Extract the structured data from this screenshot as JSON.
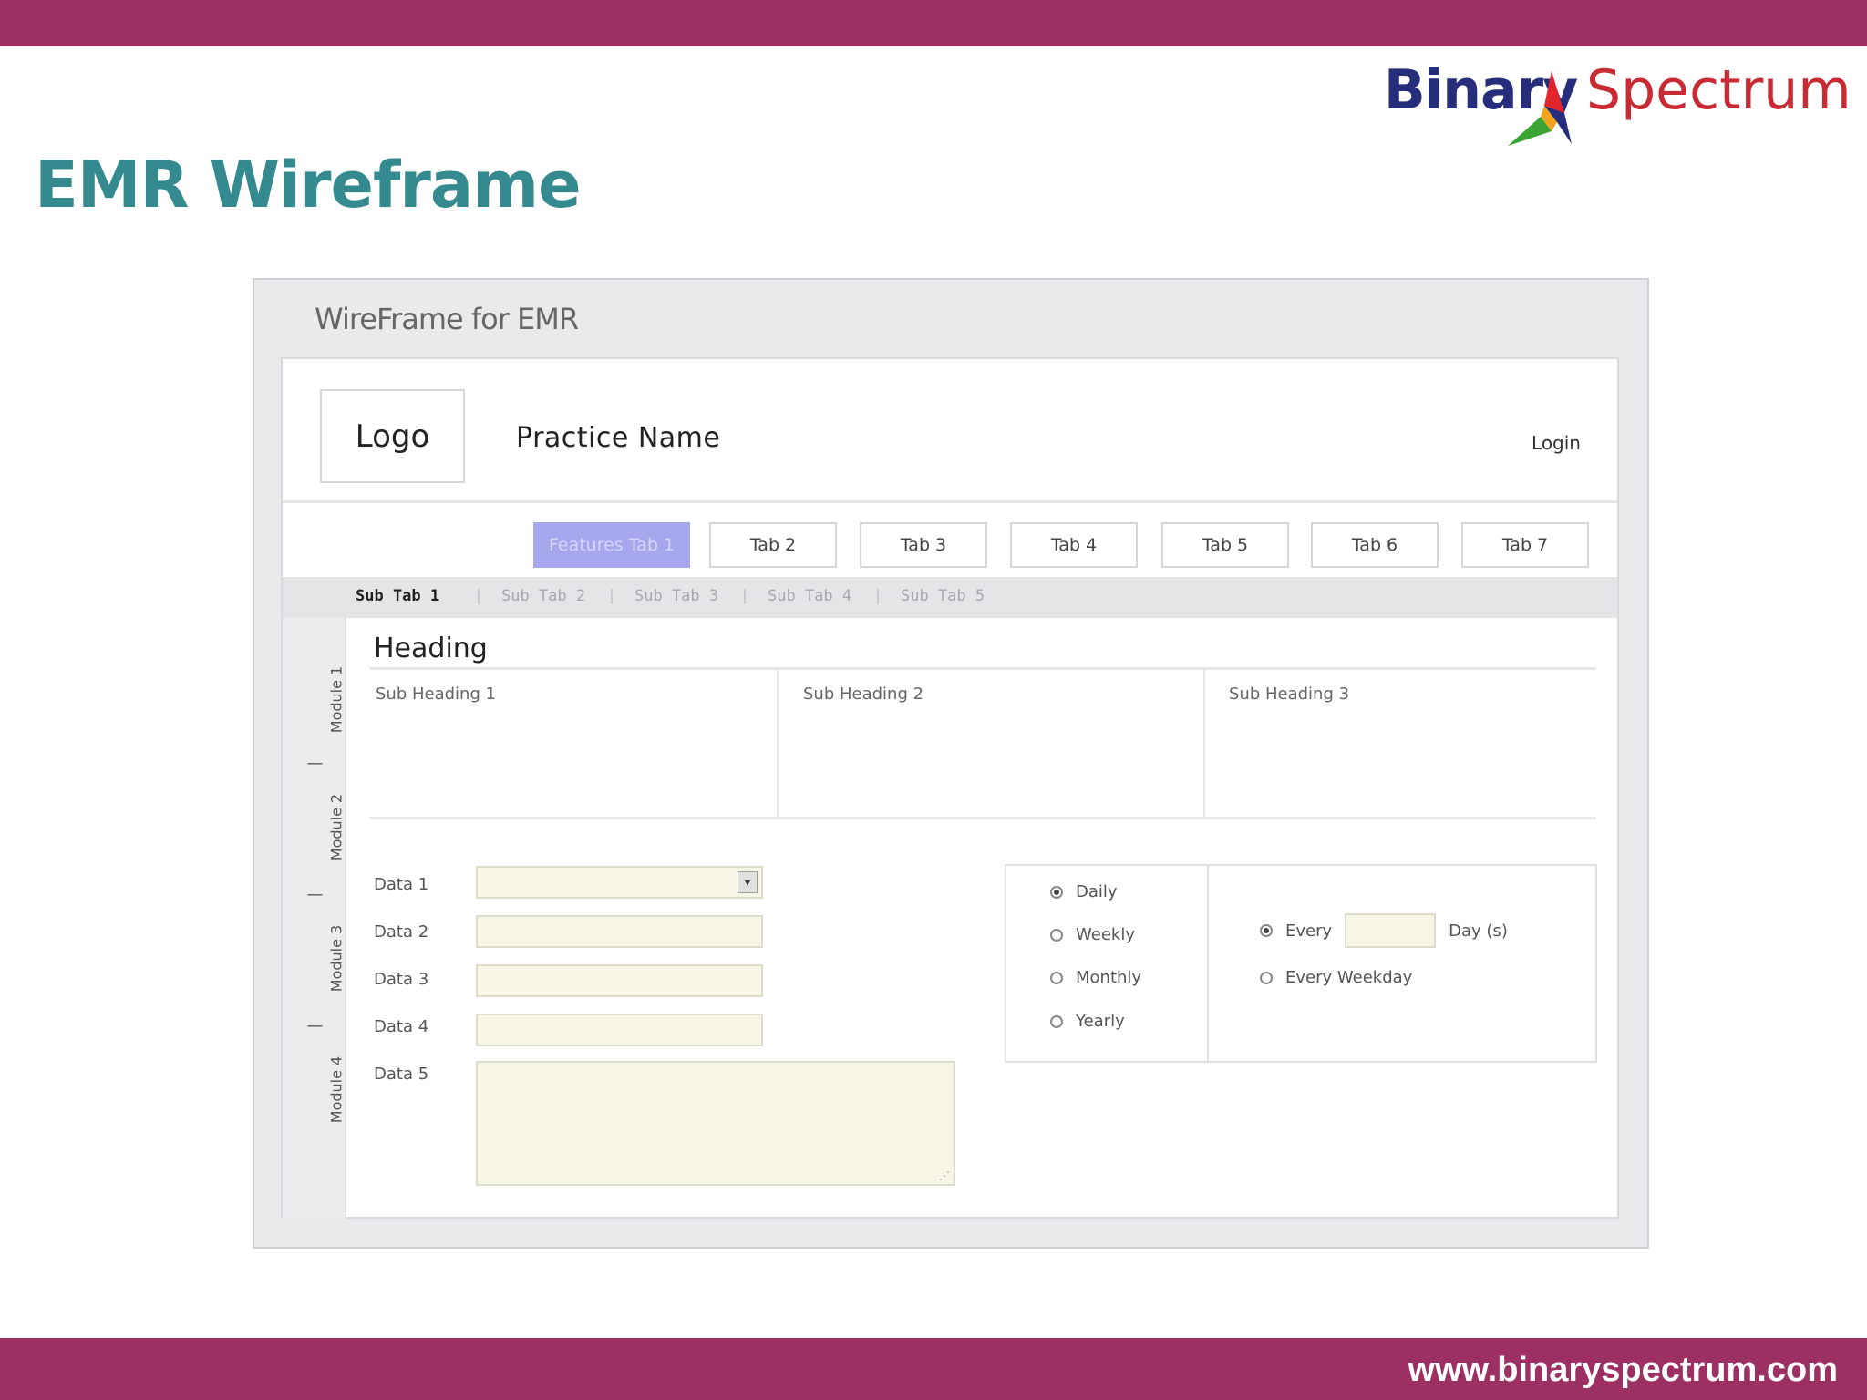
{
  "slide": {
    "title": "EMR Wireframe",
    "brand_left": "Binary",
    "brand_right": "Spectrum",
    "footer_url": "www.binaryspectrum.com"
  },
  "colors": {
    "accent_bar": "#9c3063",
    "title": "#348a8f",
    "active_tab": "#a7a7ee",
    "field_fill": "#f7f6e6"
  },
  "wireframe": {
    "title": "WireFrame for EMR",
    "header": {
      "logo": "Logo",
      "practice_name": "Practice Name",
      "login": "Login"
    },
    "tabs": [
      "Features Tab 1",
      "Tab 2",
      "Tab 3",
      "Tab 4",
      "Tab 5",
      "Tab 6",
      "Tab 7"
    ],
    "subtabs": [
      "Sub Tab 1",
      "Sub Tab 2",
      "Sub Tab 3",
      "Sub Tab 4",
      "Sub Tab 5"
    ],
    "subtab_separator": "|",
    "modules": [
      "Module 1",
      "Module 2",
      "Module 3",
      "Module 4"
    ],
    "module_separator": "|",
    "heading": "Heading",
    "sub_headings": [
      "Sub Heading 1",
      "Sub Heading 2",
      "Sub Heading 3"
    ],
    "fields": [
      "Data 1",
      "Data 2",
      "Data 3",
      "Data 4",
      "Data 5"
    ],
    "recurrence": {
      "options": [
        "Daily",
        "Weekly",
        "Monthly",
        "Yearly"
      ],
      "every_label": "Every",
      "day_unit": "Day (s)",
      "every_weekday": "Every Weekday"
    }
  }
}
